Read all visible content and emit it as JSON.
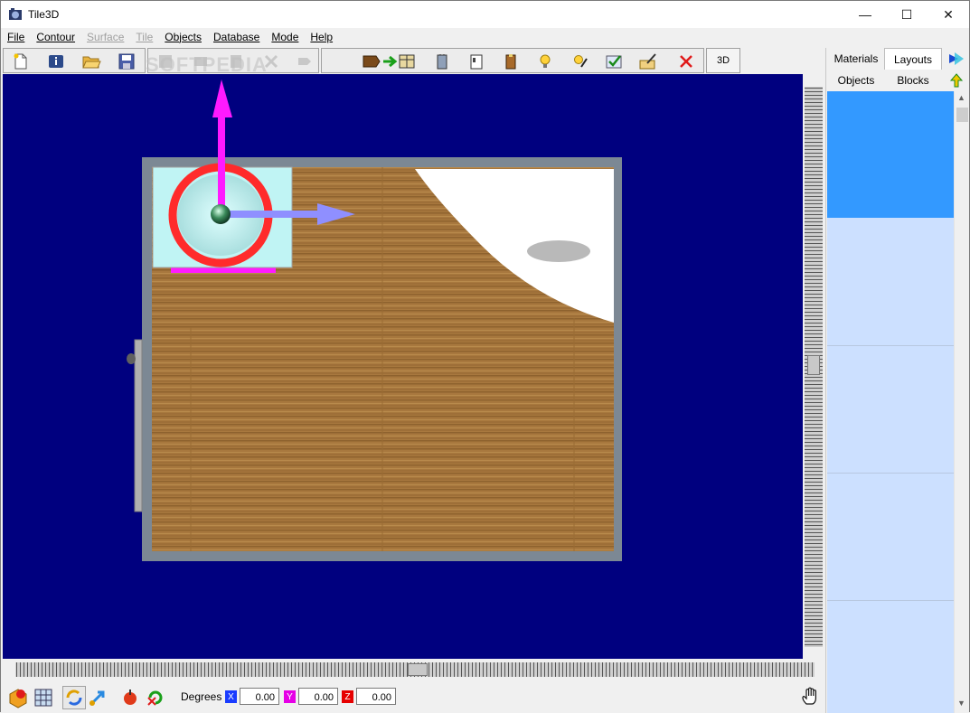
{
  "window": {
    "title": "Tile3D",
    "controls": {
      "minimize": "—",
      "maximize": "☐",
      "close": "✕"
    }
  },
  "menu": [
    {
      "label": "File",
      "enabled": true
    },
    {
      "label": "Contour",
      "enabled": true
    },
    {
      "label": "Surface",
      "enabled": false
    },
    {
      "label": "Tile",
      "enabled": false
    },
    {
      "label": "Objects",
      "enabled": true
    },
    {
      "label": "Database",
      "enabled": true
    },
    {
      "label": "Mode",
      "enabled": true
    },
    {
      "label": "Help",
      "enabled": true
    }
  ],
  "toolbar": {
    "view_3d_label": "3D",
    "watermark": "SOFTPEDIA"
  },
  "side_panel": {
    "tabs_row1": [
      "Materials",
      "Layouts"
    ],
    "tabs_row2": [
      "Objects",
      "Blocks"
    ],
    "active_tab": "Layouts"
  },
  "status": {
    "degrees_label": "Degrees",
    "axes": [
      {
        "label": "X",
        "value": "0.00",
        "color": "#1a3cff"
      },
      {
        "label": "Y",
        "value": "0.00",
        "color": "#e600e6"
      },
      {
        "label": "Z",
        "value": "0.00",
        "color": "#e60000"
      }
    ]
  },
  "colors": {
    "viewport_bg": "#00007f",
    "floor": "#a8783e",
    "wall": "#7c8894",
    "gizmo_y": "#ff1aff",
    "gizmo_x": "#8f8fff",
    "gizmo_ring": "#ff2b2b",
    "list_selected": "#3399ff",
    "list_bg": "#cce0ff"
  }
}
